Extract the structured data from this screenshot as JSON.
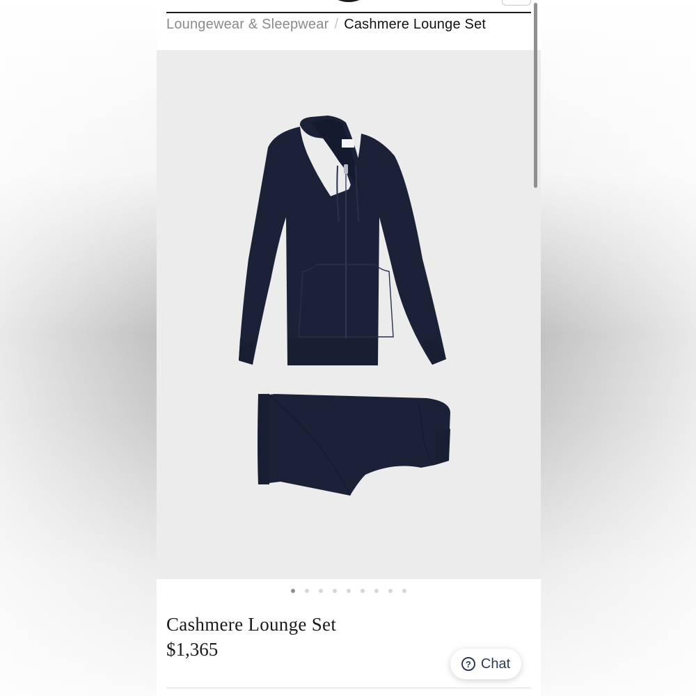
{
  "breadcrumb": {
    "parent": "Loungewear & Sleepwear",
    "separator": "/",
    "current": "Cashmere Lounge Set"
  },
  "gallery": {
    "image_count": 9,
    "active_index": 0,
    "image_subject": "navy cashmere zip hoodie and jogger trousers"
  },
  "product": {
    "title": "Cashmere Lounge Set",
    "price": "$1,365"
  },
  "chat": {
    "icon": "question-circle-icon",
    "label": "Chat"
  },
  "colors": {
    "garment_navy": "#1b2238",
    "gallery_bg": "#ececec",
    "chat_text": "#2b3a55"
  }
}
